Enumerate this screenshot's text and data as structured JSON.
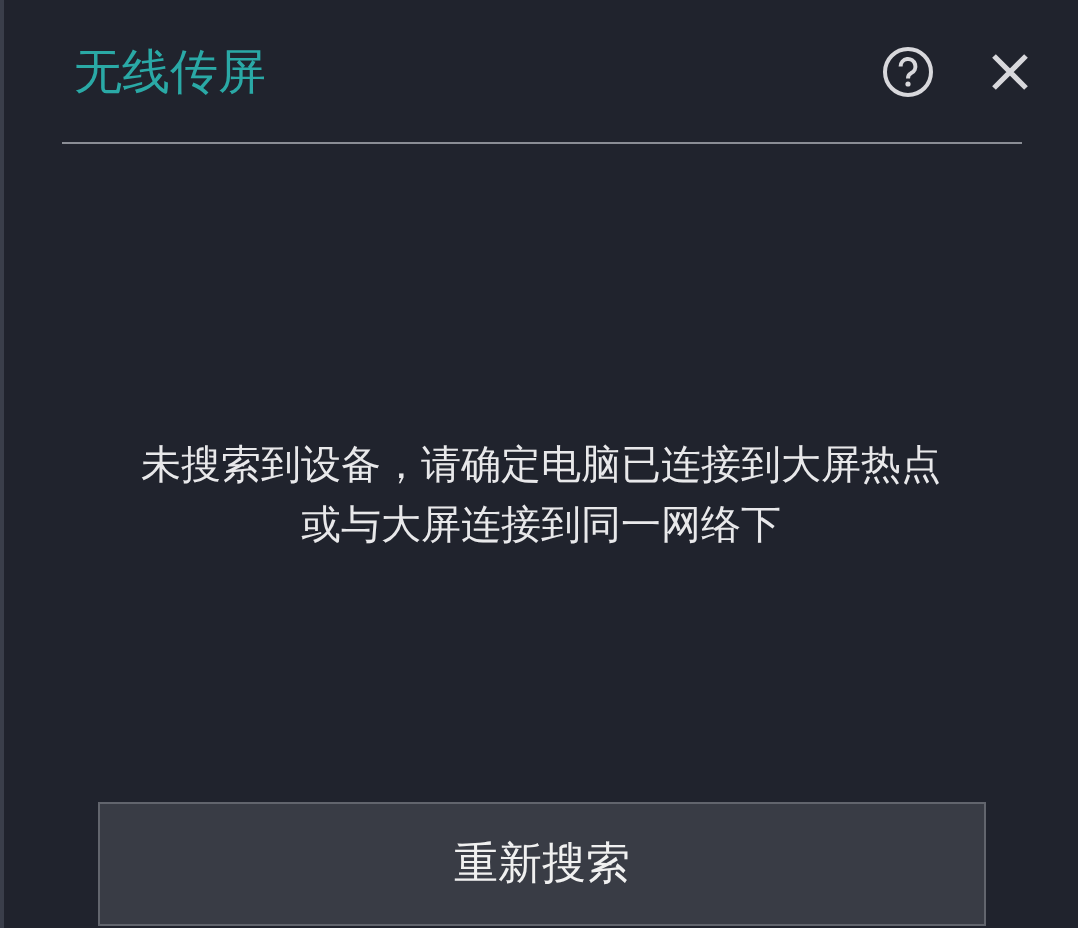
{
  "dialog": {
    "title": "无线传屏"
  },
  "message": [
    "未搜索到设备，请确定电脑已连接到大屏热点",
    "或与大屏连接到同一网络下"
  ],
  "buttons": [
    "重新搜索"
  ]
}
